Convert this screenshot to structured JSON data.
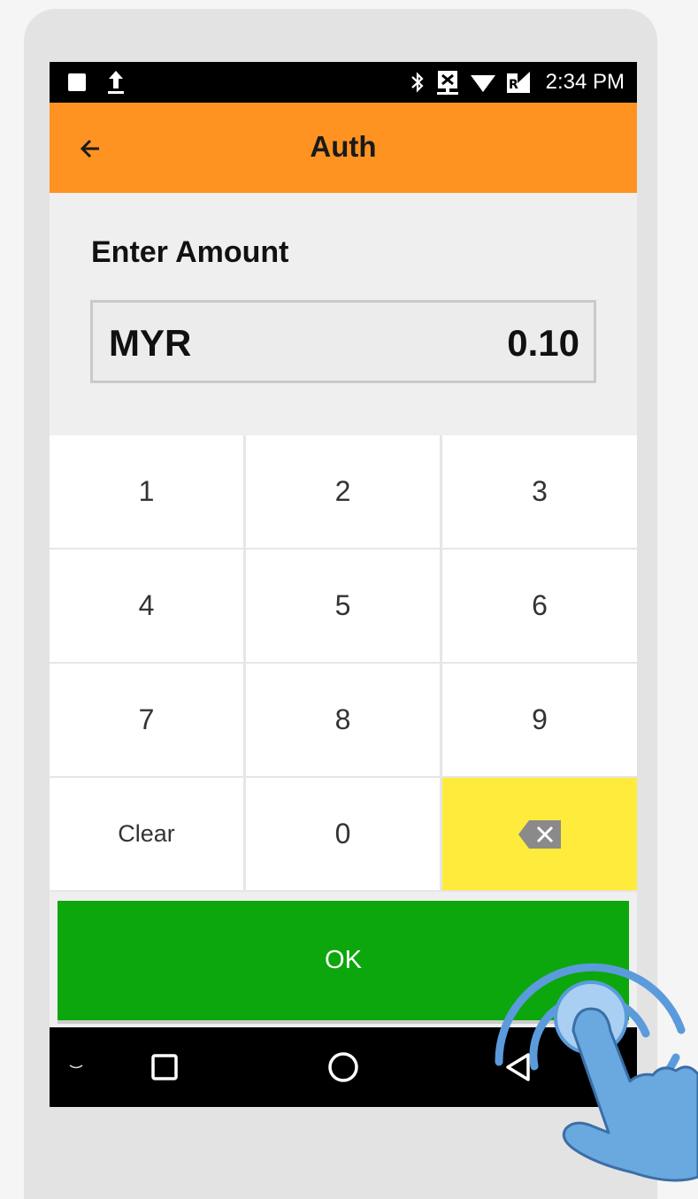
{
  "statusbar": {
    "time": "2:34 PM"
  },
  "appbar": {
    "title": "Auth"
  },
  "entry": {
    "prompt": "Enter Amount",
    "currency": "MYR",
    "amount": "0.10"
  },
  "keypad": {
    "keys": [
      "1",
      "2",
      "3",
      "4",
      "5",
      "6",
      "7",
      "8",
      "9",
      "Clear",
      "0"
    ],
    "delete_icon": "backspace-icon"
  },
  "actions": {
    "ok_label": "OK"
  },
  "colors": {
    "appbar": "#ff9322",
    "ok_button": "#0ca70c",
    "delete_key": "#ffeb3b",
    "touch_hint": "#5b9bdc"
  },
  "icons": {
    "back": "arrow-left-icon",
    "nav_hide": "chevron-down-icon",
    "nav_recents": "square-icon",
    "nav_home": "circle-icon",
    "nav_back": "triangle-back-icon",
    "overlay": "tap-gesture-hand-icon"
  }
}
